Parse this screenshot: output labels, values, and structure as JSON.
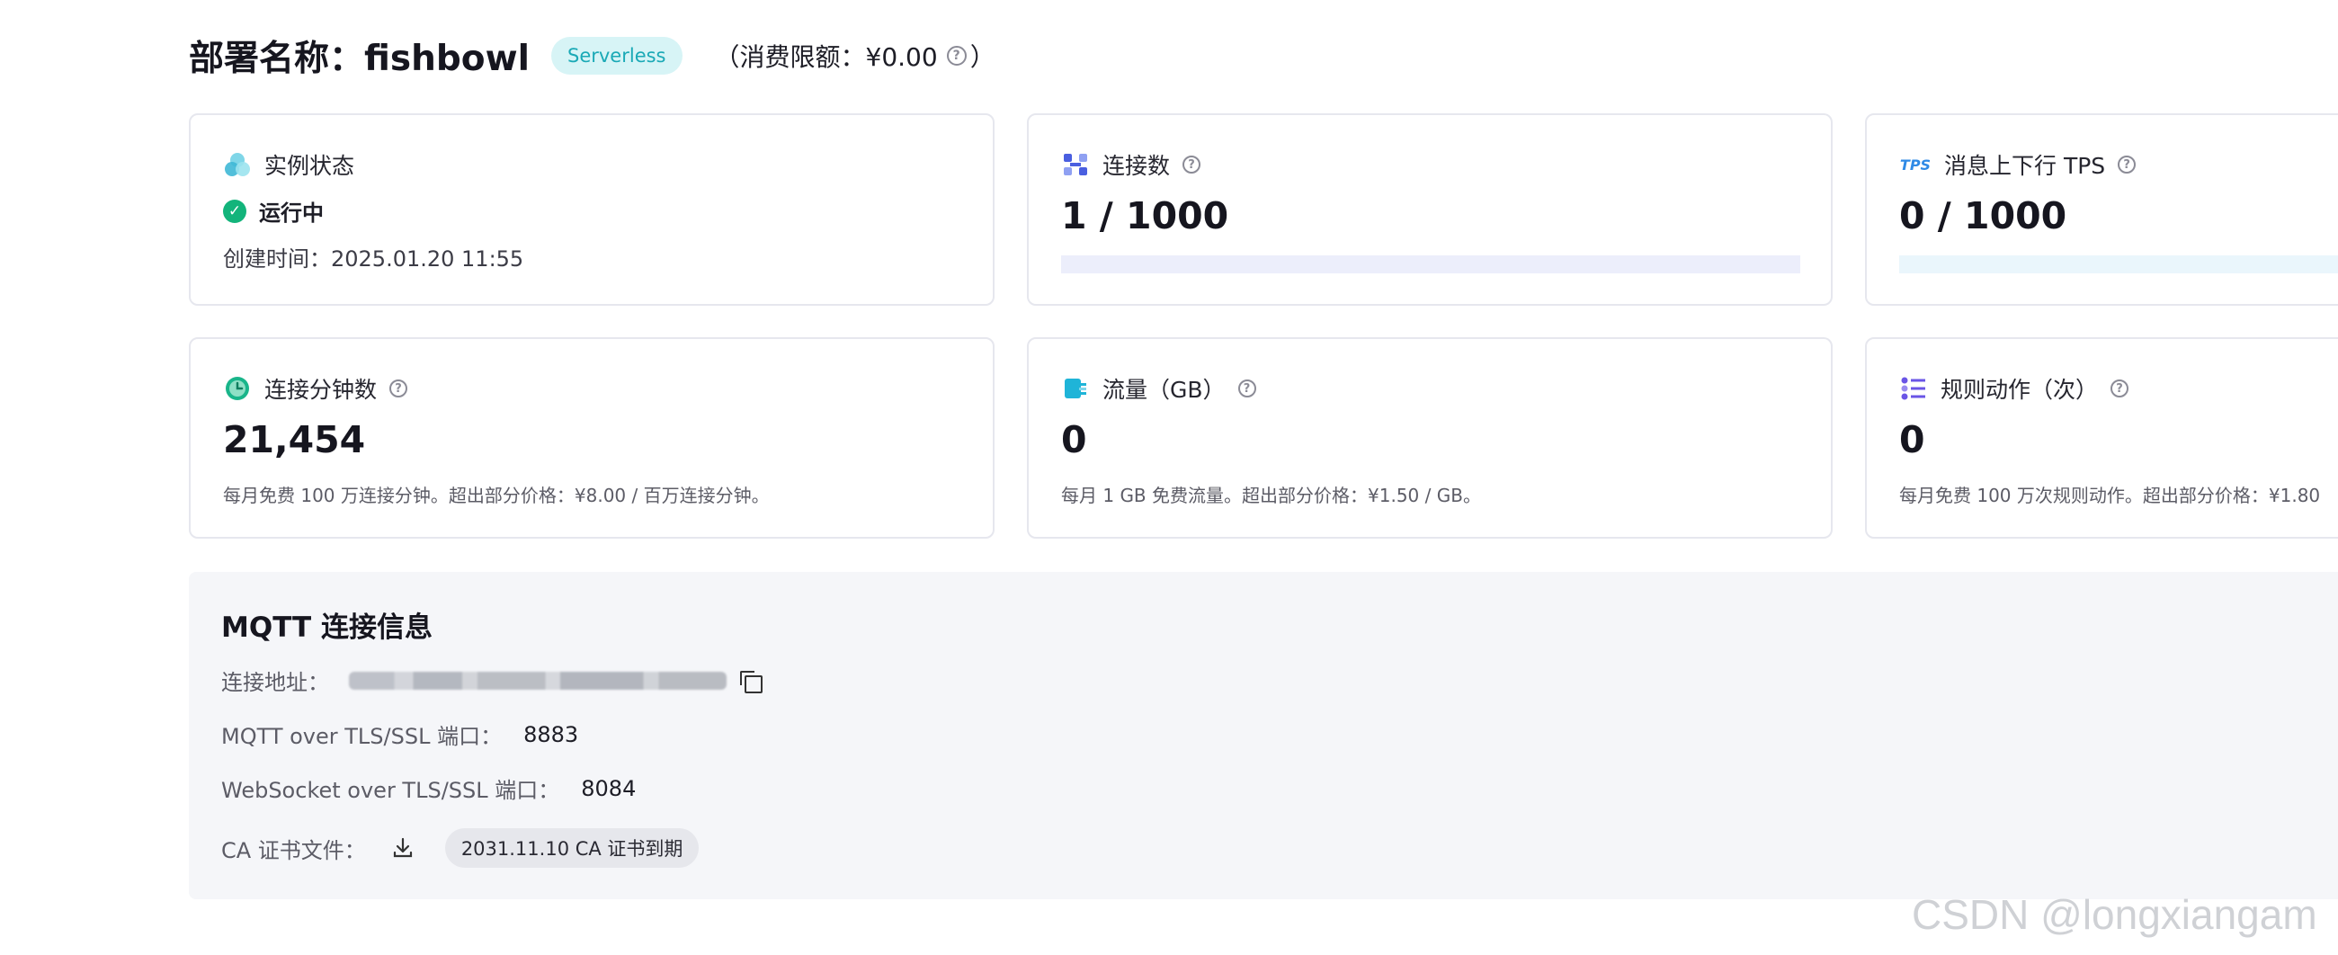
{
  "header": {
    "title": "部署名称：fishbowl",
    "badge": "Serverless",
    "limit_prefix": "（消费限额：¥0.00",
    "limit_suffix": "）"
  },
  "cards": {
    "instance": {
      "label": "实例状态",
      "status": "运行中",
      "created": "创建时间：2025.01.20 11:55",
      "status_color": "#13b47b"
    },
    "connections": {
      "label": "连接数",
      "value": "1 / 1000",
      "progress": 0.001
    },
    "tps": {
      "icon_text": "TPS",
      "label": "消息上下行 TPS",
      "value": "0 / 1000",
      "progress": 0
    },
    "conn_minutes": {
      "label": "连接分钟数",
      "value": "21,454",
      "note": "每月免费 100 万连接分钟。超出部分价格：¥8.00 / 百万连接分钟。"
    },
    "traffic": {
      "label": "流量（GB）",
      "value": "0",
      "note": "每月 1 GB 免费流量。超出部分价格：¥1.50 / GB。"
    },
    "rule_actions": {
      "label": "规则动作（次）",
      "value": "0",
      "note": "每月免费 100 万次规则动作。超出部分价格：¥1.80"
    }
  },
  "mqtt": {
    "title": "MQTT 连接信息",
    "address_label": "连接地址：",
    "tls_label": "MQTT over TLS/SSL 端口：",
    "tls_port": "8883",
    "ws_label": "WebSocket over TLS/SSL 端口：",
    "ws_port": "8084",
    "ca_label": "CA 证书文件：",
    "ca_expiry": "2031.11.10 CA 证书到期"
  },
  "watermark": "CSDN @longxiangam",
  "colors": {
    "accent_teal": "#1aa9b6",
    "success": "#13b47b",
    "icon_blue": "#4a5fe0",
    "icon_purple": "#6a55e6"
  }
}
